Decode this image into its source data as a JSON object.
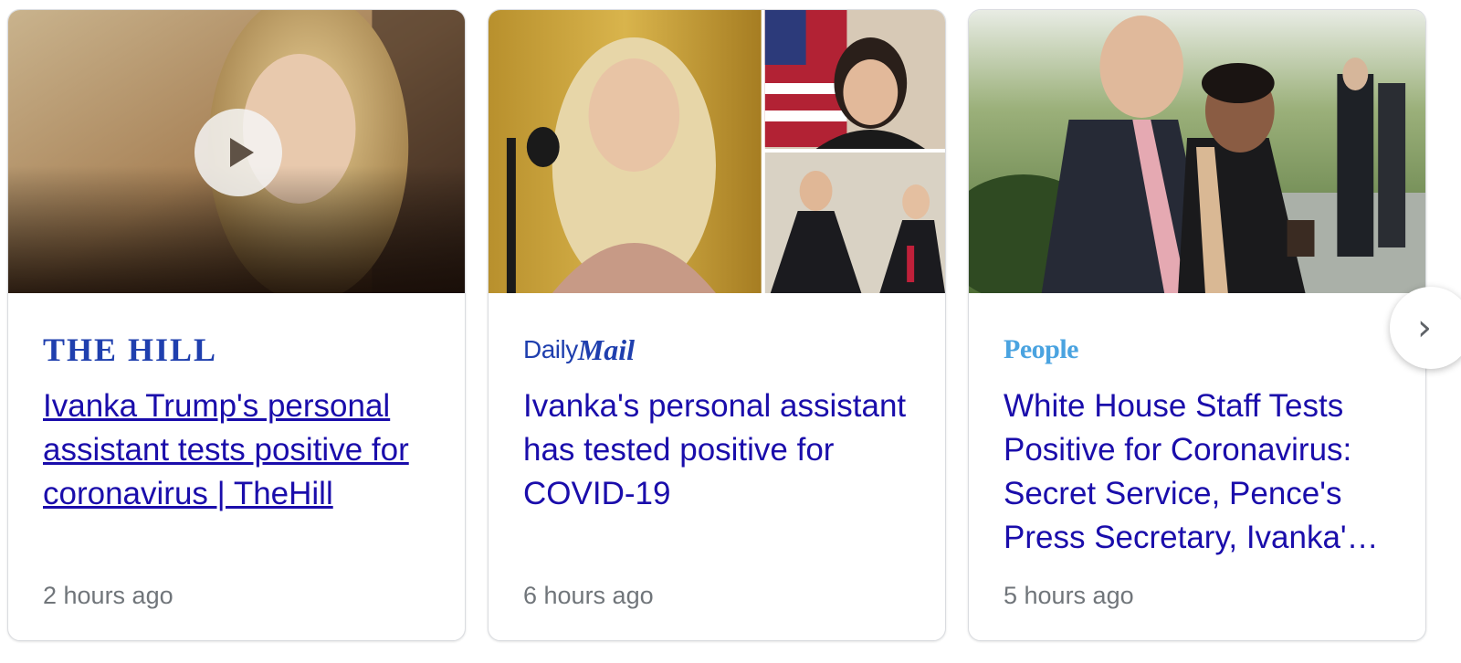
{
  "cards": [
    {
      "source": "THE HILL",
      "headline": "Ivanka Trump's personal assistant tests positive for coronavirus | TheHill",
      "time": "2 hours ago",
      "has_video": true
    },
    {
      "source_part1": "Daily",
      "source_part2": "Mail",
      "headline": "Ivanka's personal assistant has tested positive for COVID-19",
      "time": "6 hours ago",
      "has_video": false
    },
    {
      "source": "People",
      "headline": "White House Staff Tests Positive for Coronavirus: Secret Service, Pence's Press Secretary, Ivanka'…",
      "time": "5 hours ago",
      "has_video": false
    }
  ],
  "next_button": {
    "icon": "chevron-right-icon",
    "glyph": "›"
  },
  "colors": {
    "headline": "#1a0dab",
    "timestamp": "#70757a",
    "hill_brand": "#1f3fae",
    "mail_brand": "#1f3fae",
    "people_brand": "#4aa3e0"
  }
}
